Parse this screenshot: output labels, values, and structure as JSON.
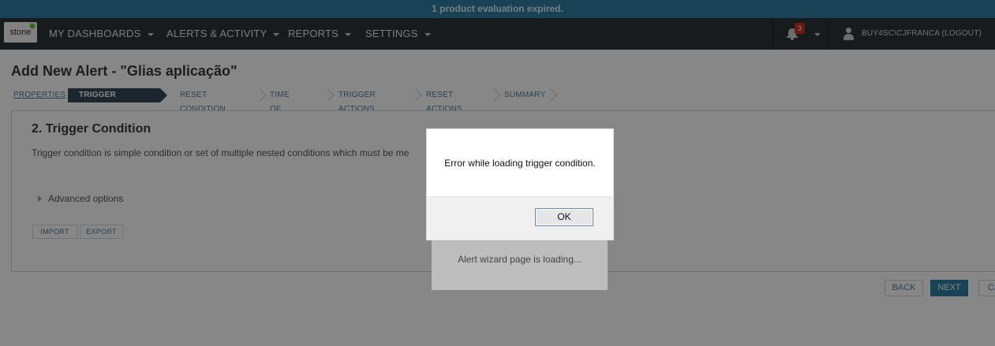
{
  "banner": {
    "text": "1 product evaluation expired."
  },
  "header": {
    "logo_text": "stone",
    "nav": [
      {
        "label": "MY DASHBOARDS"
      },
      {
        "label": "ALERTS & ACTIVITY"
      },
      {
        "label": "REPORTS"
      },
      {
        "label": "SETTINGS"
      }
    ],
    "notifications_count": "3",
    "user": "BUY4SC\\CJFRANCA (LOGOUT)"
  },
  "page": {
    "title": "Add New Alert - \"Glias aplicação\""
  },
  "wizard": {
    "steps": [
      {
        "label": "PROPERTIES",
        "state": "visited"
      },
      {
        "label": "TRIGGER CONDITION",
        "state": "active"
      },
      {
        "label": "RESET CONDITION",
        "state": "pending"
      },
      {
        "label": "TIME OF DAY",
        "state": "pending"
      },
      {
        "label": "TRIGGER ACTIONS",
        "state": "pending"
      },
      {
        "label": "RESET ACTIONS",
        "state": "pending"
      },
      {
        "label": "SUMMARY",
        "state": "pending"
      }
    ]
  },
  "section": {
    "title": "2. Trigger Condition",
    "description": "Trigger condition is simple condition or set of multiple nested conditions which must be me",
    "advanced_label": "Advanced options",
    "import_label": "IMPORT",
    "export_label": "EXPORT"
  },
  "footer": {
    "back_label": "BACK",
    "next_label": "NEXT",
    "cancel_label": "CA"
  },
  "loading": {
    "text": "Alert wizard page is loading..."
  },
  "dialog": {
    "message": "Error while loading trigger condition.",
    "ok_label": "OK"
  },
  "colors": {
    "banner": "#2e7fa3",
    "nav_bg": "#2f3338",
    "active_step": "#34495a",
    "primary_button": "#2f7fa3",
    "badge": "#c9302c"
  }
}
